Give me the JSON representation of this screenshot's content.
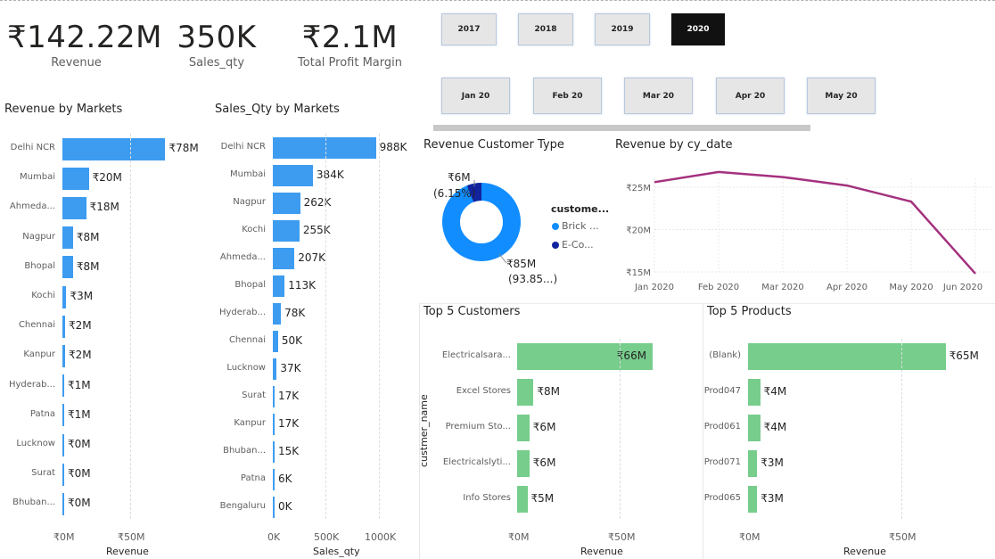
{
  "kpis": [
    {
      "value": "₹142.22M",
      "label": "Revenue"
    },
    {
      "value": "350K",
      "label": "Sales_qty"
    },
    {
      "value": "₹2.1M",
      "label": "Total Profit Margin"
    }
  ],
  "years": [
    "2017",
    "2018",
    "2019",
    "2020"
  ],
  "active_year": "2020",
  "months": [
    "Jan 20",
    "Feb 20",
    "Mar 20",
    "Apr 20",
    "May 20"
  ],
  "colors": {
    "blue": "#3d9cf0",
    "green": "#76cd8c",
    "dark_blue": "#12239e",
    "line": "#a4317e",
    "donut_blue": "#118dff"
  },
  "revenue_by_markets": {
    "title": "Revenue by Markets",
    "xlabel": "Revenue",
    "ticks": [
      "₹0M",
      "₹50M"
    ],
    "categories": [
      "Delhi NCR",
      "Mumbai",
      "Ahmeda...",
      "Nagpur",
      "Bhopal",
      "Kochi",
      "Chennai",
      "Kanpur",
      "Hyderab...",
      "Patna",
      "Lucknow",
      "Surat",
      "Bhuban..."
    ],
    "values": [
      78,
      20,
      18,
      8,
      8,
      3,
      2,
      2,
      1,
      1,
      0,
      0,
      0
    ],
    "labels": [
      "₹78M",
      "₹20M",
      "₹18M",
      "₹8M",
      "₹8M",
      "₹3M",
      "₹2M",
      "₹2M",
      "₹1M",
      "₹1M",
      "₹0M",
      "₹0M",
      "₹0M"
    ]
  },
  "sales_qty_by_markets": {
    "title": "Sales_Qty by Markets",
    "xlabel": "Sales_qty",
    "ticks": [
      "0K",
      "500K",
      "1000K"
    ],
    "categories": [
      "Delhi NCR",
      "Mumbai",
      "Nagpur",
      "Kochi",
      "Ahmeda...",
      "Bhopal",
      "Hyderab...",
      "Chennai",
      "Lucknow",
      "Surat",
      "Kanpur",
      "Bhuban...",
      "Patna",
      "Bengaluru"
    ],
    "values": [
      988,
      384,
      262,
      255,
      207,
      113,
      78,
      50,
      37,
      17,
      17,
      15,
      6,
      0
    ],
    "labels": [
      "988K",
      "384K",
      "262K",
      "255K",
      "207K",
      "113K",
      "78K",
      "50K",
      "37K",
      "17K",
      "17K",
      "15K",
      "6K",
      "0K"
    ]
  },
  "revenue_customer_type": {
    "title": "Revenue Customer Type",
    "legend_title": "custome...",
    "legend": [
      "Brick ...",
      "E-Co..."
    ],
    "small_label_1": "₹6M",
    "small_label_2": "(6.15%)",
    "big_label_1": "₹85M",
    "big_label_2": "(93.85...)",
    "shares": [
      93.85,
      6.15
    ]
  },
  "revenue_by_cy_date": {
    "title": "Revenue by cy_date",
    "x": [
      "Jan 2020",
      "Feb 2020",
      "Mar 2020",
      "Apr 2020",
      "May 2020",
      "Jun 2020"
    ],
    "y": [
      25.6,
      26.8,
      26.2,
      25.2,
      23.3,
      14.8
    ],
    "yticks": [
      "₹25M",
      "₹20M",
      "₹15M"
    ]
  },
  "top5_customers": {
    "title": "Top 5 Customers",
    "ylabel": "custmer_name",
    "xlabel": "Revenue",
    "ticks": [
      "₹0M",
      "₹50M"
    ],
    "categories": [
      "Electricalsara...",
      "Excel Stores",
      "Premium Sto...",
      "Electricalslyti...",
      "Info Stores"
    ],
    "values": [
      66,
      8,
      6,
      6,
      5
    ],
    "labels": [
      "₹66M",
      "₹8M",
      "₹6M",
      "₹6M",
      "₹5M"
    ]
  },
  "top5_products": {
    "title": "Top 5 Products",
    "xlabel": "Revenue",
    "ticks": [
      "₹0M",
      "₹50M"
    ],
    "categories": [
      "(Blank)",
      "Prod047",
      "Prod061",
      "Prod071",
      "Prod065"
    ],
    "values": [
      65,
      4,
      4,
      3,
      3
    ],
    "labels": [
      "₹65M",
      "₹4M",
      "₹4M",
      "₹3M",
      "₹3M"
    ]
  }
}
